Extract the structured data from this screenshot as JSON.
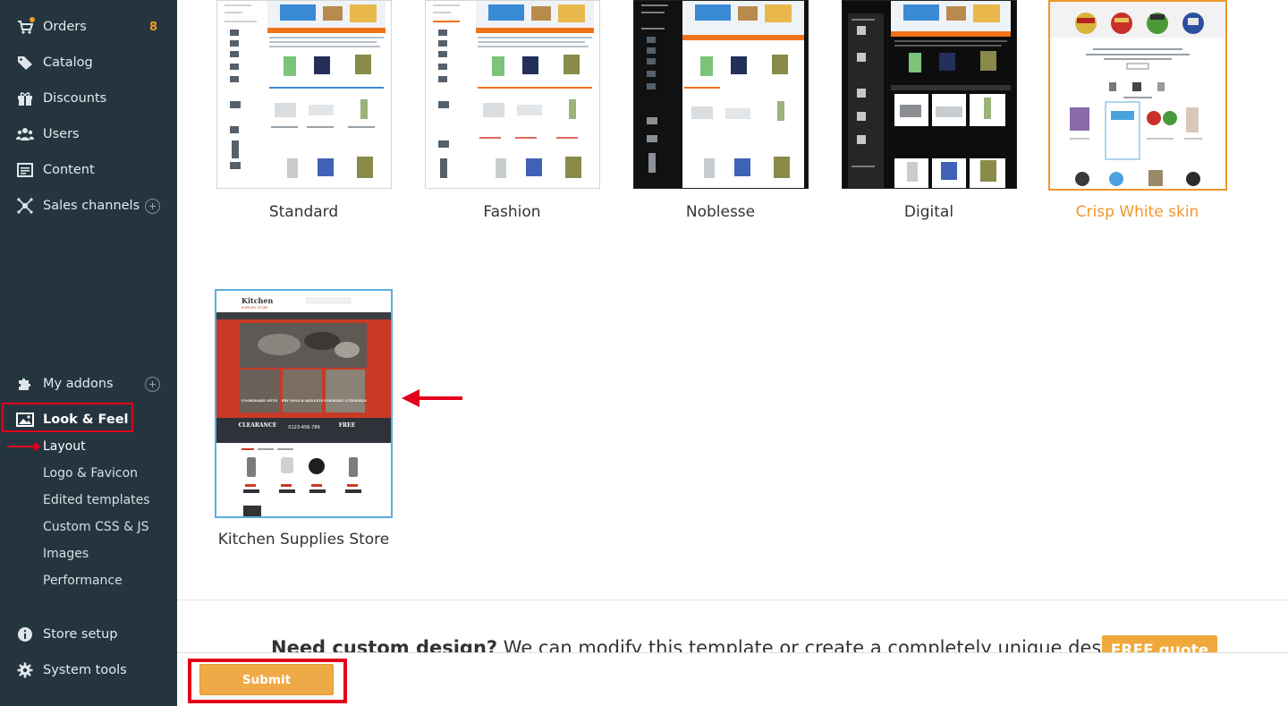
{
  "sidebar": {
    "items": [
      {
        "label": "Orders",
        "icon": "orders-icon",
        "count": "8"
      },
      {
        "label": "Catalog",
        "icon": "catalog-icon"
      },
      {
        "label": "Discounts",
        "icon": "discounts-icon"
      },
      {
        "label": "Users",
        "icon": "users-icon"
      },
      {
        "label": "Content",
        "icon": "content-icon"
      },
      {
        "label": "Sales channels",
        "icon": "sales-channels-icon"
      },
      {
        "label": "My addons",
        "icon": "addons-icon"
      },
      {
        "label": "Look & Feel",
        "icon": "image-icon"
      },
      {
        "label": "Store setup",
        "icon": "info-icon"
      },
      {
        "label": "System tools",
        "icon": "gear-icon"
      }
    ],
    "look_and_feel_sub": [
      {
        "label": "Layout"
      },
      {
        "label": "Logo & Favicon"
      },
      {
        "label": "Edited templates"
      },
      {
        "label": "Custom CSS & JS"
      },
      {
        "label": "Images"
      },
      {
        "label": "Performance"
      }
    ]
  },
  "templates": [
    {
      "name": "Standard",
      "selected": false
    },
    {
      "name": "Fashion",
      "selected": false
    },
    {
      "name": "Noblesse",
      "selected": false
    },
    {
      "name": "Digital",
      "selected": false
    },
    {
      "name": "Crisp White skin",
      "selected": true
    },
    {
      "name": "Kitchen Supplies Store",
      "selected": false
    }
  ],
  "kitchen_preview": {
    "logo": "Kitchen",
    "logo_sub": "SUPPLIES STORE",
    "cards": [
      "COOKWARE SETS",
      "FRY PANS & SKILLETS",
      "COOKING UTENSILS"
    ],
    "promo_left": "CLEARANCE",
    "promo_phone": "0123-456-789",
    "promo_right": "FREE"
  },
  "crisp_preview": {
    "welcome": "Welcome to X-Cart Demo Store!",
    "featured": "Featured products"
  },
  "promo": {
    "bold": "Need custom design?",
    "text": " We can modify this template or create a completely unique design for you.",
    "button": "FREE quote"
  },
  "footer": {
    "submit_label": "Submit"
  },
  "colors": {
    "sidebar_bg": "#253540",
    "accent_orange": "#f0962c",
    "selection_blue": "#5aaee0",
    "annotation_red": "#e3001b"
  }
}
